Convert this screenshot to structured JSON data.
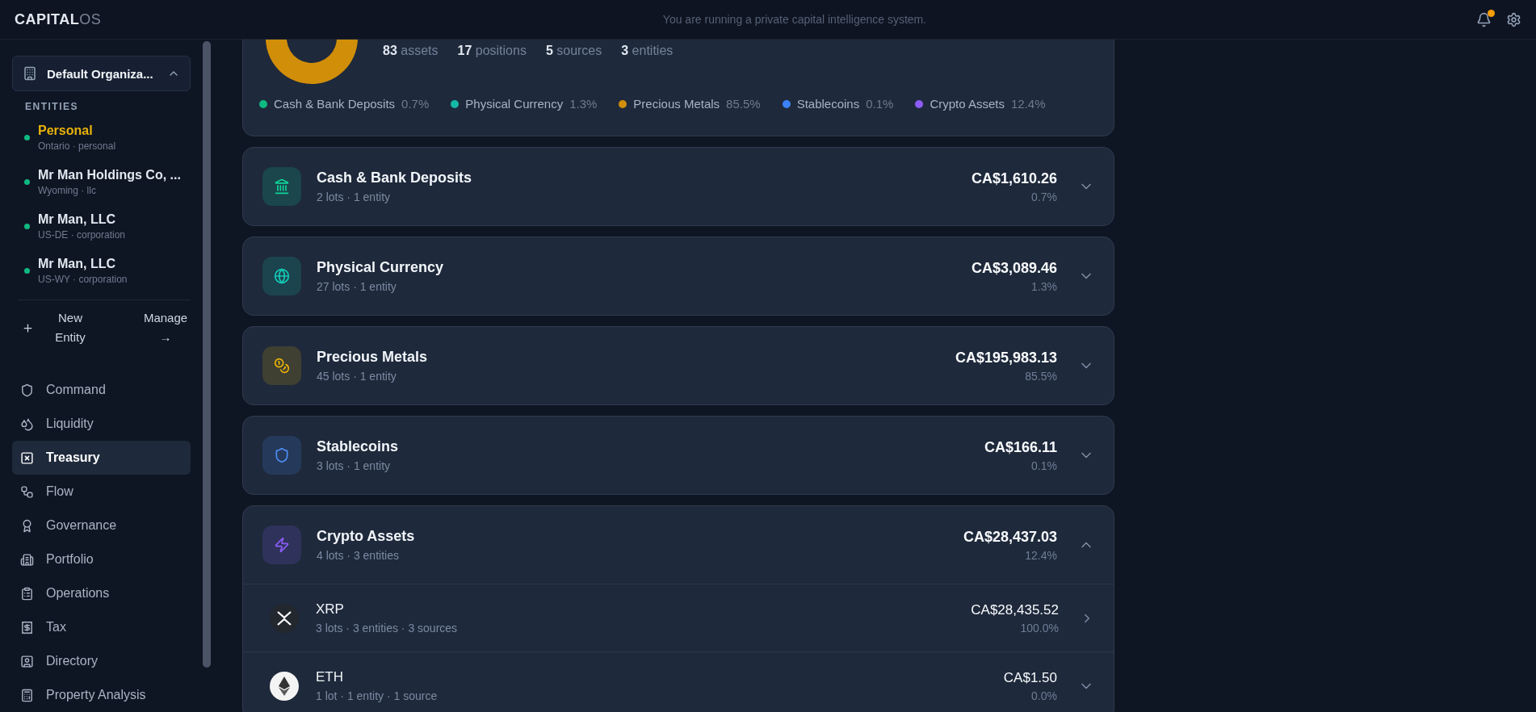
{
  "header": {
    "logo_main": "CAPITAL",
    "logo_accent": "OS",
    "tagline": "You are running a private capital intelligence system.",
    "notifications": {
      "unread": true
    }
  },
  "sidebar": {
    "organization": {
      "name": "Default Organiza...",
      "expanded": true
    },
    "entities_heading": "ENTITIES",
    "entities": [
      {
        "name": "Personal",
        "sub": "Ontario · personal",
        "selected": true,
        "color": "#10b981"
      },
      {
        "name": "Mr Man Holdings Co, ...",
        "sub": "Wyoming · llc",
        "selected": false,
        "color": "#10b981"
      },
      {
        "name": "Mr Man, LLC",
        "sub": "US-DE · corporation",
        "selected": false,
        "color": "#10b981"
      },
      {
        "name": "Mr Man, LLC",
        "sub": "US-WY · corporation",
        "selected": false,
        "color": "#10b981"
      }
    ],
    "actions": [
      "New Entity",
      "Manage →"
    ],
    "nav": [
      {
        "label": "Command",
        "selected": false
      },
      {
        "label": "Liquidity",
        "selected": false
      },
      {
        "label": "Treasury",
        "selected": true
      },
      {
        "label": "Flow",
        "selected": false
      },
      {
        "label": "Governance",
        "selected": false
      },
      {
        "label": "Portfolio",
        "selected": false
      },
      {
        "label": "Operations",
        "selected": false
      },
      {
        "label": "Tax",
        "selected": false
      },
      {
        "label": "Directory",
        "selected": false
      },
      {
        "label": "Property Analysis",
        "selected": false
      }
    ]
  },
  "summary": {
    "stats": [
      "**83** assets",
      "**17** positions",
      "**5** sources",
      "**3** entities"
    ],
    "legend": [
      {
        "label": "Cash & Bank Deposits",
        "pct": "0.7%",
        "color": "#10b981"
      },
      {
        "label": "Physical Currency",
        "pct": "1.3%",
        "color": "#14b8a6"
      },
      {
        "label": "Precious Metals",
        "pct": "85.5%",
        "color": "#d18e09"
      },
      {
        "label": "Stablecoins",
        "pct": "0.1%",
        "color": "#3b82f6"
      },
      {
        "label": "Crypto Assets",
        "pct": "12.4%",
        "color": "#8b5cf6"
      }
    ]
  },
  "categories": [
    {
      "name": "Cash & Bank Deposits",
      "sub": "2 lots · 1 entity",
      "amount": "CA$1,610.26",
      "pct": "0.7%",
      "color": "#10d39a",
      "expanded": false
    },
    {
      "name": "Physical Currency",
      "sub": "27 lots · 1 entity",
      "amount": "CA$3,089.46",
      "pct": "1.3%",
      "color": "#14c8b4",
      "expanded": false
    },
    {
      "name": "Precious Metals",
      "sub": "45 lots · 1 entity",
      "amount": "CA$195,983.13",
      "pct": "85.5%",
      "color": "#eab308",
      "expanded": false
    },
    {
      "name": "Stablecoins",
      "sub": "3 lots · 1 entity",
      "amount": "CA$166.11",
      "pct": "0.1%",
      "color": "#4f8ff7",
      "expanded": false
    },
    {
      "name": "Crypto Assets",
      "sub": "4 lots · 3 entities",
      "amount": "CA$28,437.03",
      "pct": "12.4%",
      "color": "#8b5cf6",
      "expanded": true,
      "children": [
        {
          "name": "XRP",
          "sub": "3 lots · 3 entities · 3 sources",
          "amount": "CA$28,435.52",
          "pct": "100.0%",
          "kind": "detail"
        },
        {
          "name": "ETH",
          "sub": "1 lot · 1 entity · 1 source",
          "amount": "CA$1.50",
          "pct": "0.0%",
          "kind": "group"
        }
      ]
    }
  ]
}
